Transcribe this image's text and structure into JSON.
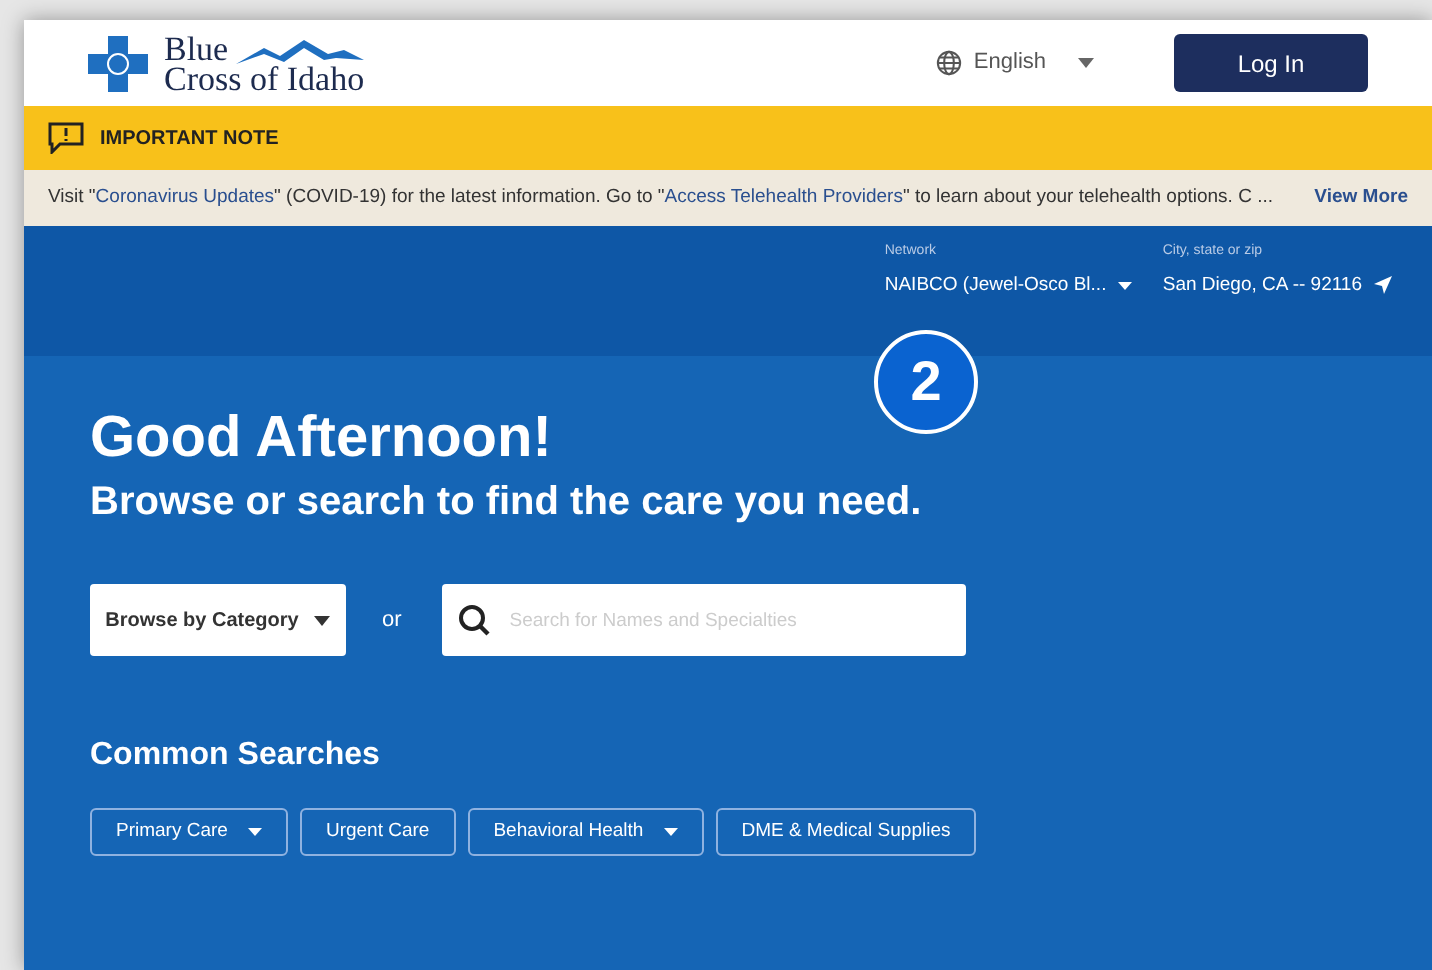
{
  "logo": {
    "line_1": "Blue",
    "line_2": "Cross of Idaho"
  },
  "language": {
    "label": "English"
  },
  "login_button": "Log In",
  "important_note": {
    "title": "IMPORTANT NOTE"
  },
  "notice": {
    "segments": [
      {
        "kind": "text",
        "text": "Visit \""
      },
      {
        "kind": "link",
        "text": "Coronavirus Updates"
      },
      {
        "kind": "text",
        "text": "\" (COVID-19) for the latest information. Go to \""
      },
      {
        "kind": "link",
        "text": "Access Telehealth Providers"
      },
      {
        "kind": "text",
        "text": "\" to learn about your telehealth options. C ..."
      }
    ],
    "view_more": "View More"
  },
  "network": {
    "label": "Network",
    "value": "NAIBCO (Jewel-Osco Bl..."
  },
  "location": {
    "label": "City, state or zip",
    "value": "San Diego, CA -- 92116"
  },
  "step_badge": "2",
  "greeting": "Good Afternoon!",
  "subtitle": "Browse or search to find the care you need.",
  "browse_button": "Browse by Category",
  "or_label": "or",
  "search": {
    "placeholder": "Search for Names and Specialties"
  },
  "common_searches": {
    "title": "Common Searches",
    "items": [
      {
        "label": "Primary Care",
        "dropdown": true
      },
      {
        "label": "Urgent Care",
        "dropdown": false
      },
      {
        "label": "Behavioral Health",
        "dropdown": true
      },
      {
        "label": "DME & Medical Supplies",
        "dropdown": false
      }
    ]
  }
}
